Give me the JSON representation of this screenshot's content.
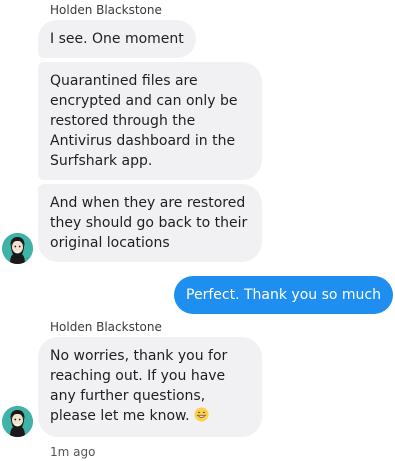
{
  "groups": [
    {
      "sender": "Holden Blackstone",
      "messages": [
        "I see. One moment",
        "Quarantined files are encrypted and can only be restored through the Antivirus dashboard in the Surfshark app.",
        "And when they are restored they should go back to their original locations"
      ],
      "avatar_icon": "agent-avatar-icon"
    },
    {
      "outgoing_message": "Perfect. Thank you so much"
    },
    {
      "sender": "Holden Blackstone",
      "message": "No worries, thank you for reaching out. If you have any further questions, please let me know.",
      "emoji_icon": "grinning-face-emoji",
      "avatar_icon": "agent-avatar-icon",
      "timestamp": "1m ago"
    }
  ],
  "colors": {
    "incoming_bubble": "#f1f1f3",
    "outgoing_bubble": "#1f8ef1",
    "avatar_background": "#3fb3a8"
  }
}
